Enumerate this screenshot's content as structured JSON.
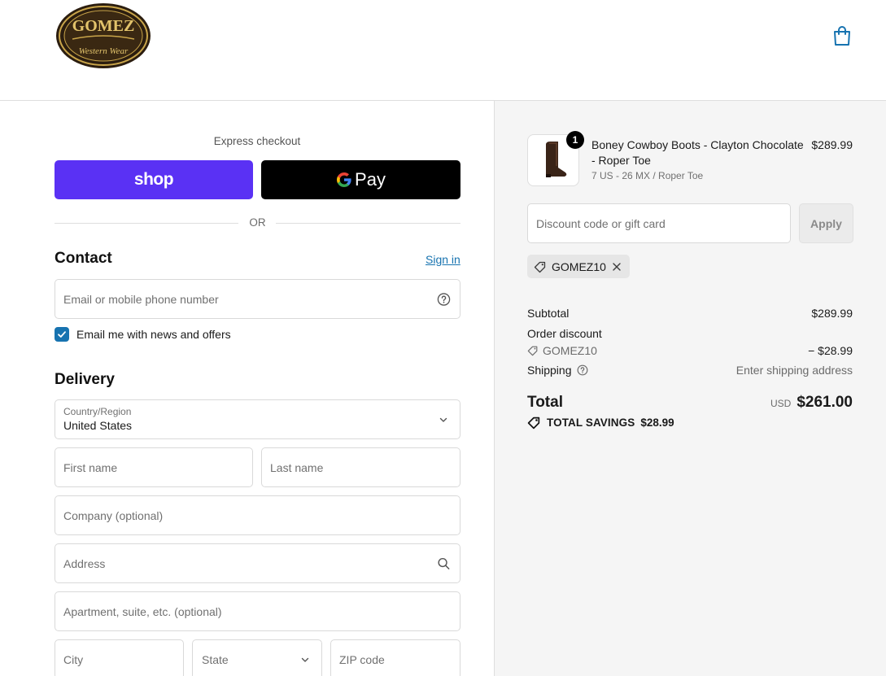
{
  "header": {
    "logo": {
      "text_top": "GOMEZ",
      "text_bottom": "Western Wear"
    },
    "cart_icon": "shopping-bag-icon"
  },
  "checkout": {
    "express_label": "Express checkout",
    "shop_pay_label": "shop",
    "gpay_label": "Pay",
    "or_label": "OR",
    "contact": {
      "title": "Contact",
      "sign_in": "Sign in",
      "email_placeholder": "Email or mobile phone number",
      "newsletter_label": "Email me with news and offers",
      "newsletter_checked": true
    },
    "delivery": {
      "title": "Delivery",
      "country_label": "Country/Region",
      "country_value": "United States",
      "first_name_placeholder": "First name",
      "last_name_placeholder": "Last name",
      "company_placeholder": "Company (optional)",
      "address_placeholder": "Address",
      "apartment_placeholder": "Apartment, suite, etc. (optional)",
      "city_placeholder": "City",
      "state_label": "State",
      "zip_placeholder": "ZIP code"
    }
  },
  "summary": {
    "item": {
      "quantity": "1",
      "name": "Boney Cowboy Boots - Clayton Chocolate - Roper Toe",
      "variant": "7 US - 26 MX / Roper Toe",
      "price": "$289.99"
    },
    "discount_placeholder": "Discount code or gift card",
    "apply_label": "Apply",
    "applied_code": "GOMEZ10",
    "subtotal_label": "Subtotal",
    "subtotal_value": "$289.99",
    "order_discount_label": "Order discount",
    "discount_code": "GOMEZ10",
    "discount_value": "− $28.99",
    "shipping_label": "Shipping",
    "shipping_value": "Enter shipping address",
    "total_label": "Total",
    "currency": "USD",
    "total_value": "$261.00",
    "savings_label": "TOTAL SAVINGS",
    "savings_value": "$28.99"
  },
  "colors": {
    "shop_pay": "#5a31f4",
    "link": "#1773b0",
    "checkbox": "#1773b0",
    "summary_bg": "#f5f5f5"
  }
}
